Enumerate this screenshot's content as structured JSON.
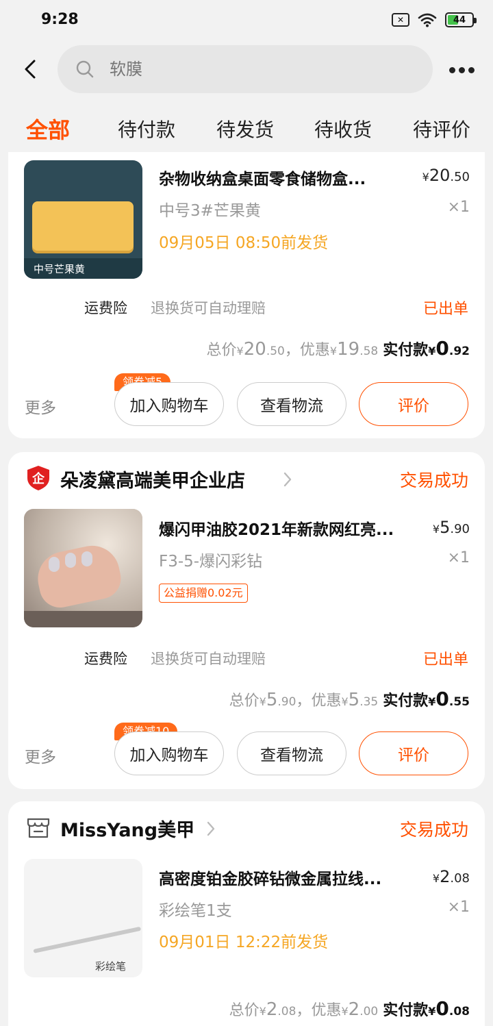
{
  "status_bar": {
    "time": "9:28",
    "sim": "✕",
    "battery": "44",
    "battery_level": 0.44
  },
  "search": {
    "placeholder": "软膜"
  },
  "tabs": [
    "全部",
    "待付款",
    "待发货",
    "待收货",
    "待评价"
  ],
  "orders": [
    {
      "shop_name": "",
      "status": "",
      "item": {
        "title": "杂物收纳盒桌面零食储物盒...",
        "price_int": "20",
        "price_dec": ".50",
        "spec": "中号3#芒果黄",
        "qty": "×1",
        "ship_time": "09月05日 08:50前发货",
        "thumb_caption": "中号芒果黄"
      },
      "insurance": {
        "label": "运费险",
        "desc": "退换货可自动理赔",
        "status": "已出单"
      },
      "totals": {
        "total_label": "总价",
        "total_int": "20",
        "total_dec": ".50",
        "discount_label": "优惠",
        "discount_int": "19",
        "discount_dec": ".58",
        "paid_label": "实付款",
        "paid_int": "0",
        "paid_dec": ".92"
      },
      "actions": {
        "more": "更多",
        "coupon": "领券减5",
        "cart": "加入购物车",
        "logistics": "查看物流",
        "review": "评价"
      }
    },
    {
      "shop_name": "朵凌黛高端美甲企业店",
      "status": "交易成功",
      "item": {
        "title": "爆闪甲油胶2021年新款网红亮...",
        "price_int": "5",
        "price_dec": ".90",
        "spec": "F3-5-爆闪彩钻",
        "qty": "×1",
        "charity": "公益捐赠0.02元"
      },
      "insurance": {
        "label": "运费险",
        "desc": "退换货可自动理赔",
        "status": "已出单"
      },
      "totals": {
        "total_label": "总价",
        "total_int": "5",
        "total_dec": ".90",
        "discount_label": "优惠",
        "discount_int": "5",
        "discount_dec": ".35",
        "paid_label": "实付款",
        "paid_int": "0",
        "paid_dec": ".55"
      },
      "actions": {
        "more": "更多",
        "coupon": "领券减10",
        "cart": "加入购物车",
        "logistics": "查看物流",
        "review": "评价"
      }
    },
    {
      "shop_name": "MissYang美甲",
      "status": "交易成功",
      "item": {
        "title": "高密度铂金胶碎钻微金属拉线...",
        "price_int": "2",
        "price_dec": ".08",
        "spec": "彩绘笔1支",
        "qty": "×1",
        "ship_time": "09月01日 12:22前发货",
        "thumb_caption": "彩绘笔"
      },
      "totals": {
        "total_label": "总价",
        "total_int": "2",
        "total_dec": ".08",
        "discount_label": "优惠",
        "discount_int": "2",
        "discount_dec": ".00",
        "paid_label": "实付款",
        "paid_int": "0",
        "paid_dec": ".08"
      }
    }
  ],
  "currency": "¥",
  "colors": {
    "accent": "#ff5000",
    "ship_time": "#f5a623",
    "background": "#f2f2f2"
  }
}
